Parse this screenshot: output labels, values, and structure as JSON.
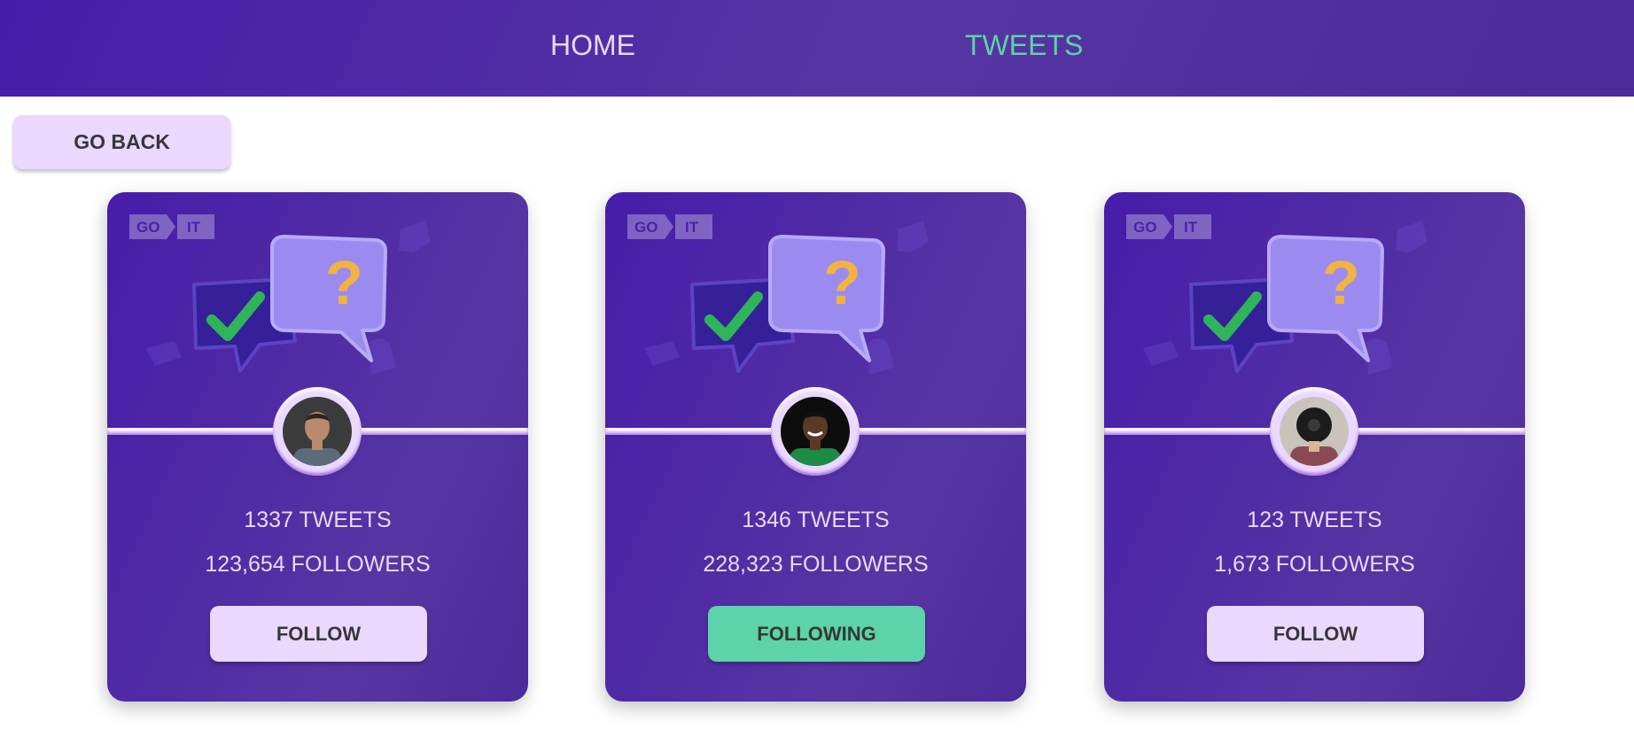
{
  "nav": {
    "home_label": "HOME",
    "tweets_label": "TWEETS",
    "active": "TWEETS"
  },
  "go_back_label": "GO BACK",
  "logo": {
    "text_left": "GO",
    "text_right": "IT"
  },
  "colors": {
    "header_bg": "#4b2a99",
    "card_bg": "#5736a3",
    "accent_light": "#ebd8ff",
    "accent_green": "#5cd3a8",
    "button_text": "#373737",
    "question_mark": "#f3b340",
    "check_mark": "#2fb45a"
  },
  "icons": [
    "checkmark-speech-bubble-icon",
    "question-speech-bubble-icon"
  ],
  "cards": [
    {
      "tweets": "1337",
      "tweets_suffix": "TWEETS",
      "followers": "123,654",
      "followers_suffix": "FOLLOWERS",
      "button_label": "FOLLOW",
      "button_bg": "#ebd8ff",
      "avatar": {
        "skin": "#b98a6e",
        "shirt": "#5b6b7a",
        "bg": "#3b3b3b",
        "hair": "#2a2320"
      }
    },
    {
      "tweets": "1346",
      "tweets_suffix": "TWEETS",
      "followers": "228,323",
      "followers_suffix": "FOLLOWERS",
      "button_label": "FOLLOWING",
      "button_bg": "#5cd3a8",
      "avatar": {
        "skin": "#5a3a26",
        "shirt": "#1d8a45",
        "bg": "#0d0d0d",
        "hair": "#111111"
      }
    },
    {
      "tweets": "123",
      "tweets_suffix": "TWEETS",
      "followers": "1,673",
      "followers_suffix": "FOLLOWERS",
      "button_label": "FOLLOW",
      "button_bg": "#ebd8ff",
      "avatar": {
        "skin": "#d9b59a",
        "shirt": "#8a4a52",
        "bg": "#c9c4bb",
        "hair": "#1c1c1c"
      }
    }
  ]
}
